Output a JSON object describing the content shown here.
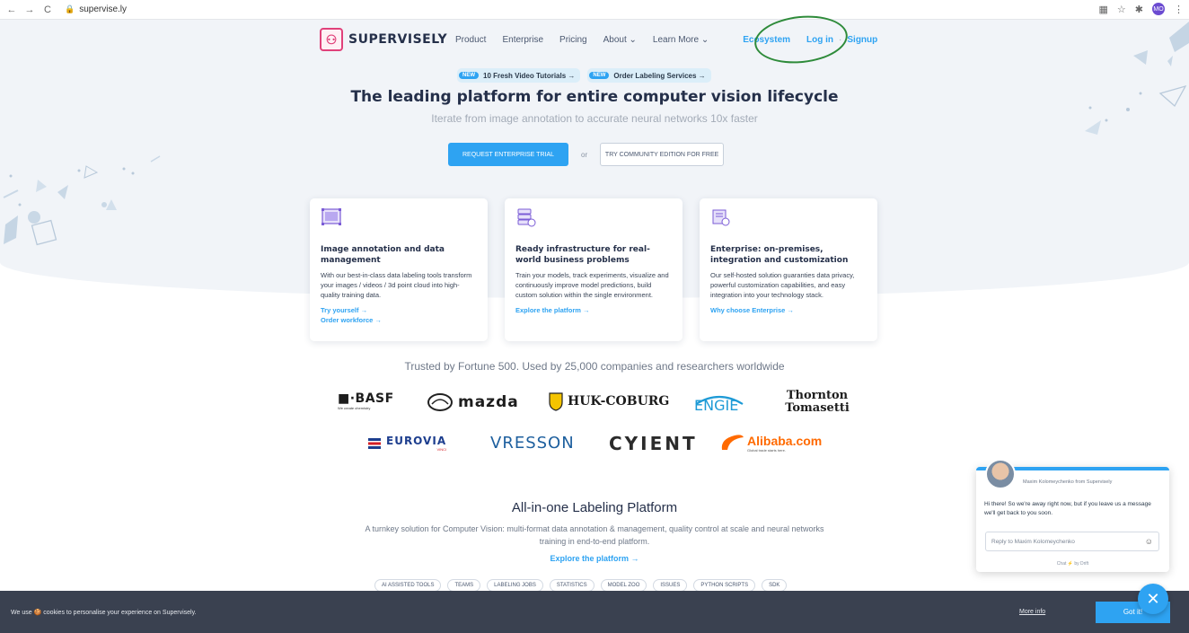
{
  "browser": {
    "url": "supervise.ly",
    "profile_initials": "MO"
  },
  "header": {
    "logo_text": "SUPERVISELY",
    "nav": [
      "Product",
      "Enterprise",
      "Pricing",
      "About ⌄",
      "Learn More ⌄"
    ],
    "ecosystem": "Ecosystem",
    "login": "Log in",
    "separator": "·",
    "signup": "Signup"
  },
  "badges": [
    {
      "pill": "NEW",
      "label": "10 Fresh Video Tutorials →"
    },
    {
      "pill": "NEW",
      "label": "Order Labeling Services →"
    }
  ],
  "hero": {
    "headline": "The leading platform for entire computer vision lifecycle",
    "subheadline": "Iterate from image annotation to accurate neural networks 10x faster",
    "primary_cta": "REQUEST ENTERPRISE TRIAL",
    "or": "or",
    "secondary_cta": "TRY COMMUNITY EDITION FOR FREE"
  },
  "cards": [
    {
      "title": "Image annotation and data management",
      "text": "With our best-in-class data labeling tools transform your images / videos / 3d point cloud into high-quality training data.",
      "links": [
        "Try yourself →",
        "Order workforce →"
      ]
    },
    {
      "title": "Ready infrastructure for real-world business problems",
      "text": "Train your models, track experiments, visualize and continuously improve model predictions, build custom solution within the single environment.",
      "links": [
        "Explore the platform →"
      ]
    },
    {
      "title": "Enterprise: on-premises, integration and customization",
      "text": "Our self-hosted solution guaranties data privacy, powerful customization capabilities, and easy integration into your technology stack.",
      "links": [
        "Why choose Enterprise →"
      ]
    }
  ],
  "trusted": "Trusted by Fortune 500. Used by 25,000 companies and researchers worldwide",
  "logos": {
    "basf": "■·BASF",
    "basf_tag": "We create chemistry",
    "mazda": "mazda",
    "huk": "HUK-COBURG",
    "engie": "ENGIE",
    "thornton": "Thornton Tomasetti",
    "eurovia": "EUROVIA",
    "eurovia_tag": "VINCI",
    "vresson": "VRESSON",
    "cyient": "CYIENT",
    "alibaba": "Alibaba.com",
    "alibaba_tag": "Global trade starts here."
  },
  "aio": {
    "title": "All-in-one Labeling Platform",
    "subtitle": "A turnkey solution for Computer Vision: multi-format data annotation & management, quality control at scale and neural networks training in end-to-end platform.",
    "link": "Explore the platform →",
    "tags": [
      "AI ASSISTED TOOLS",
      "TEAMS",
      "LABELING JOBS",
      "STATISTICS",
      "MODEL ZOO",
      "ISSUES",
      "PYTHON SCRIPTS",
      "SDK"
    ]
  },
  "cookie": {
    "text": "We use 🍪 cookies to personalise your experience on Supervisely.",
    "more": "More info",
    "accept": "Got it!"
  },
  "chat": {
    "from": "Maxim Kolomeychenko from Supervisely",
    "message": "Hi there! So we're away right now, but if you leave us a message we'll get back to you soon.",
    "reply_placeholder": "Reply to Maxim Kolomeychenko",
    "by": "Chat ⚡ by Drift"
  }
}
